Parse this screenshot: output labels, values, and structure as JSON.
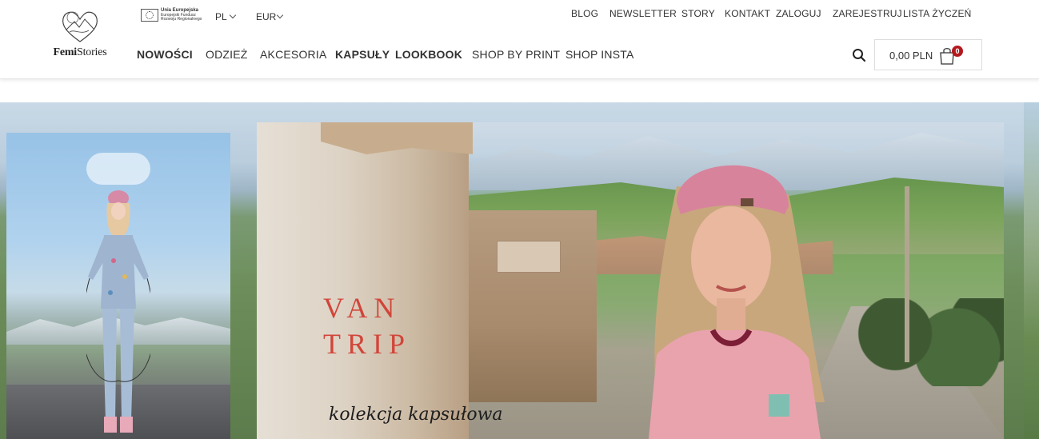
{
  "brand": {
    "logo_text_bold": "Femi",
    "logo_text_regular": "Stories"
  },
  "eu_badge": {
    "title": "Unia Europejska",
    "line1": "Europejski Fundusz",
    "line2": "Rozwoju Regionalnego"
  },
  "language": {
    "selected": "PL"
  },
  "currency": {
    "selected": "EUR"
  },
  "top_links": [
    "BLOG",
    "NEWSLETTER",
    "STORY",
    "KONTAKT",
    "ZALOGUJ",
    "ZAREJESTRUJ",
    "LISTA ŻYCZEŃ"
  ],
  "main_nav": [
    {
      "label": "NOWOŚCI",
      "bold": true
    },
    {
      "label": "ODZIEŻ",
      "bold": false
    },
    {
      "label": "AKCESORIA",
      "bold": false
    },
    {
      "label": "KAPSUŁY",
      "bold": true
    },
    {
      "label": "LOOKBOOK",
      "bold": true
    },
    {
      "label": "SHOP BY PRINT",
      "bold": false
    },
    {
      "label": "SHOP INSTA",
      "bold": false
    }
  ],
  "cart": {
    "amount": "0,00 PLN",
    "count": "0"
  },
  "icons": {
    "search": "search-icon",
    "cart": "shopping-bag-icon",
    "logo": "heart-mountain-logo-icon"
  },
  "colors": {
    "accent_red": "#d2453a",
    "badge_red": "#b3191f"
  },
  "hero": {
    "title_line1": "VAN",
    "title_line2": "TRIP",
    "subtitle": "kolekcja kapsułowa"
  }
}
